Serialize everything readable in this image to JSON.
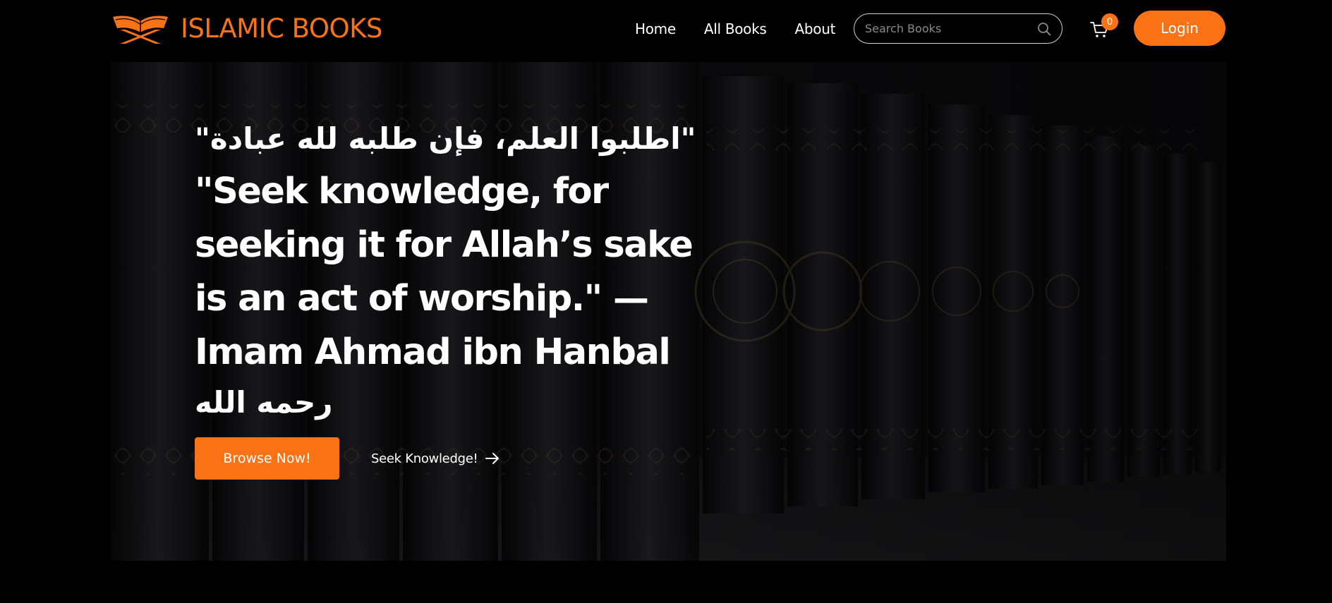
{
  "brand": {
    "name": "ISLAMIC BOOKS",
    "accent_color": "#f97316",
    "logo_icon": "quran-on-stand-icon"
  },
  "nav": {
    "links": [
      {
        "label": "Home"
      },
      {
        "label": "All Books"
      },
      {
        "label": "About"
      }
    ]
  },
  "search": {
    "placeholder": "Search Books",
    "value": "",
    "icon": "search-icon"
  },
  "cart": {
    "icon": "cart-icon",
    "count": "0"
  },
  "auth": {
    "login_label": "Login"
  },
  "hero": {
    "background": "bookshelf-of-islamic-books-image",
    "quote_arabic": "\"اطلبوا العلم، فإن طلبه لله عبادة\"",
    "quote_english": "\"Seek knowledge, for seeking it for Allah’s sake is an act of worship.\" — Imam Ahmad ibn Hanbal",
    "quote_arabic_end": "رحمه الله",
    "primary_button": "Browse Now!",
    "secondary_link": "Seek Knowledge!",
    "secondary_icon": "arrow-right-icon"
  }
}
